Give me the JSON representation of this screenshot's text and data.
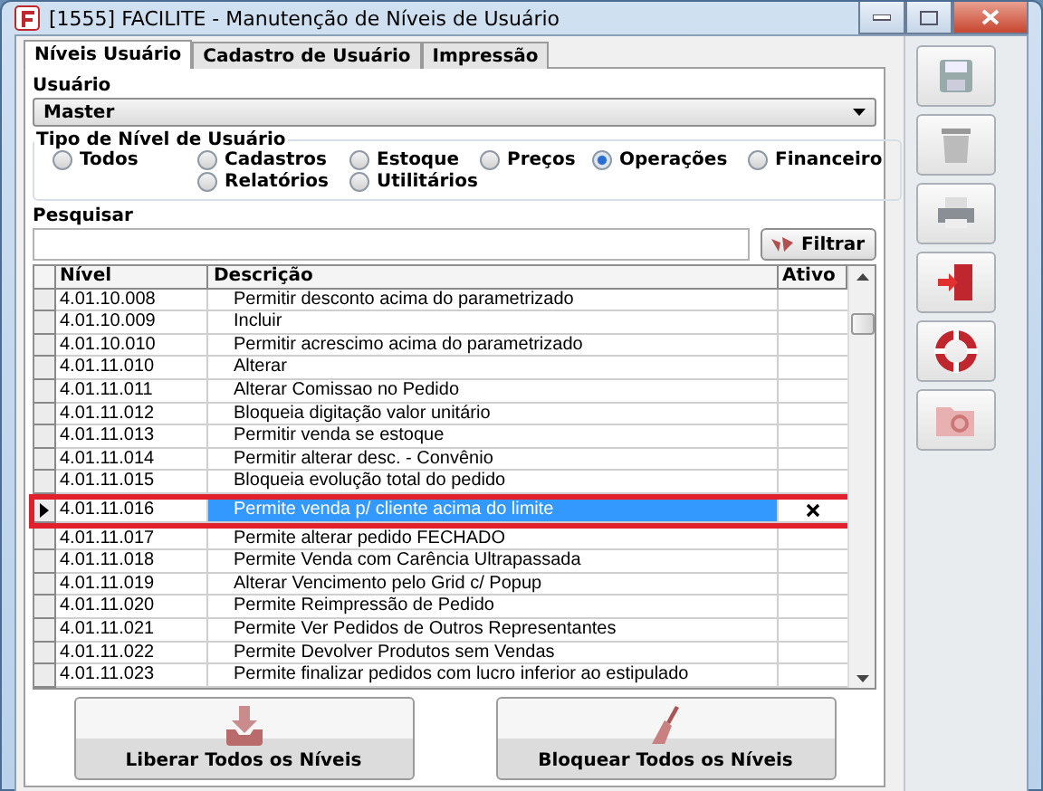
{
  "window": {
    "title": "[1555] FACILITE - Manutenção de Níveis de Usuário"
  },
  "tabs": [
    {
      "label": "Níveis Usuário",
      "selected": true
    },
    {
      "label": "Cadastro de Usuário",
      "selected": false
    },
    {
      "label": "Impressão",
      "selected": false
    }
  ],
  "user_field": {
    "label": "Usuário",
    "value": "Master"
  },
  "level_type": {
    "label": "Tipo de Nível de Usuário",
    "options": [
      {
        "label": "Todos",
        "selected": false
      },
      {
        "label": "Cadastros",
        "selected": false
      },
      {
        "label": "Estoque",
        "selected": false
      },
      {
        "label": "Preços",
        "selected": false
      },
      {
        "label": "Operações",
        "selected": true
      },
      {
        "label": "Financeiro",
        "selected": false
      },
      {
        "label": "Relatórios",
        "selected": false
      },
      {
        "label": "Utilitários",
        "selected": false
      }
    ]
  },
  "search": {
    "label": "Pesquisar",
    "button": "Filtrar"
  },
  "table": {
    "columns": [
      "Nível",
      "Descrição",
      "Ativo"
    ],
    "rows": [
      {
        "level": "4.01.10.008",
        "description": "Permitir desconto acima do parametrizado",
        "active": false,
        "selected": false
      },
      {
        "level": "4.01.10.009",
        "description": "Incluir",
        "active": false,
        "selected": false
      },
      {
        "level": "4.01.10.010",
        "description": "Permitir acrescimo acima do parametrizado",
        "active": false,
        "selected": false
      },
      {
        "level": "4.01.11.010",
        "description": "Alterar",
        "active": false,
        "selected": false
      },
      {
        "level": "4.01.11.011",
        "description": "Alterar Comissao no Pedido",
        "active": false,
        "selected": false
      },
      {
        "level": "4.01.11.012",
        "description": "Bloqueia digitação valor unitário",
        "active": false,
        "selected": false
      },
      {
        "level": "4.01.11.013",
        "description": "Permitir venda se estoque",
        "active": false,
        "selected": false
      },
      {
        "level": "4.01.11.014",
        "description": "Permitir alterar desc. - Convênio",
        "active": false,
        "selected": false
      },
      {
        "level": "4.01.11.015",
        "description": "Bloqueia evolução total do pedido",
        "active": false,
        "selected": false
      },
      {
        "level": "4.01.11.016",
        "description": "Permite venda p/ cliente acima do limite",
        "active": true,
        "selected": true
      },
      {
        "level": "4.01.11.017",
        "description": "Permite alterar pedido FECHADO",
        "active": false,
        "selected": false
      },
      {
        "level": "4.01.11.018",
        "description": "Permite Venda com Carência Ultrapassada",
        "active": false,
        "selected": false
      },
      {
        "level": "4.01.11.019",
        "description": "Alterar Vencimento pelo Grid c/ Popup",
        "active": false,
        "selected": false
      },
      {
        "level": "4.01.11.020",
        "description": "Permite Reimpressão de Pedido",
        "active": false,
        "selected": false
      },
      {
        "level": "4.01.11.021",
        "description": "Permite Ver Pedidos de Outros Representantes",
        "active": false,
        "selected": false
      },
      {
        "level": "4.01.11.022",
        "description": "Permite Devolver Produtos sem Vendas",
        "active": false,
        "selected": false
      },
      {
        "level": "4.01.11.023",
        "description": "Permite finalizar pedidos com lucro inferior ao estipulado",
        "active": false,
        "selected": false
      }
    ]
  },
  "actions": [
    {
      "kind": "release",
      "label": "Liberar Todos os Níveis"
    },
    {
      "kind": "block",
      "label": "Bloquear Todos os Níveis"
    }
  ]
}
